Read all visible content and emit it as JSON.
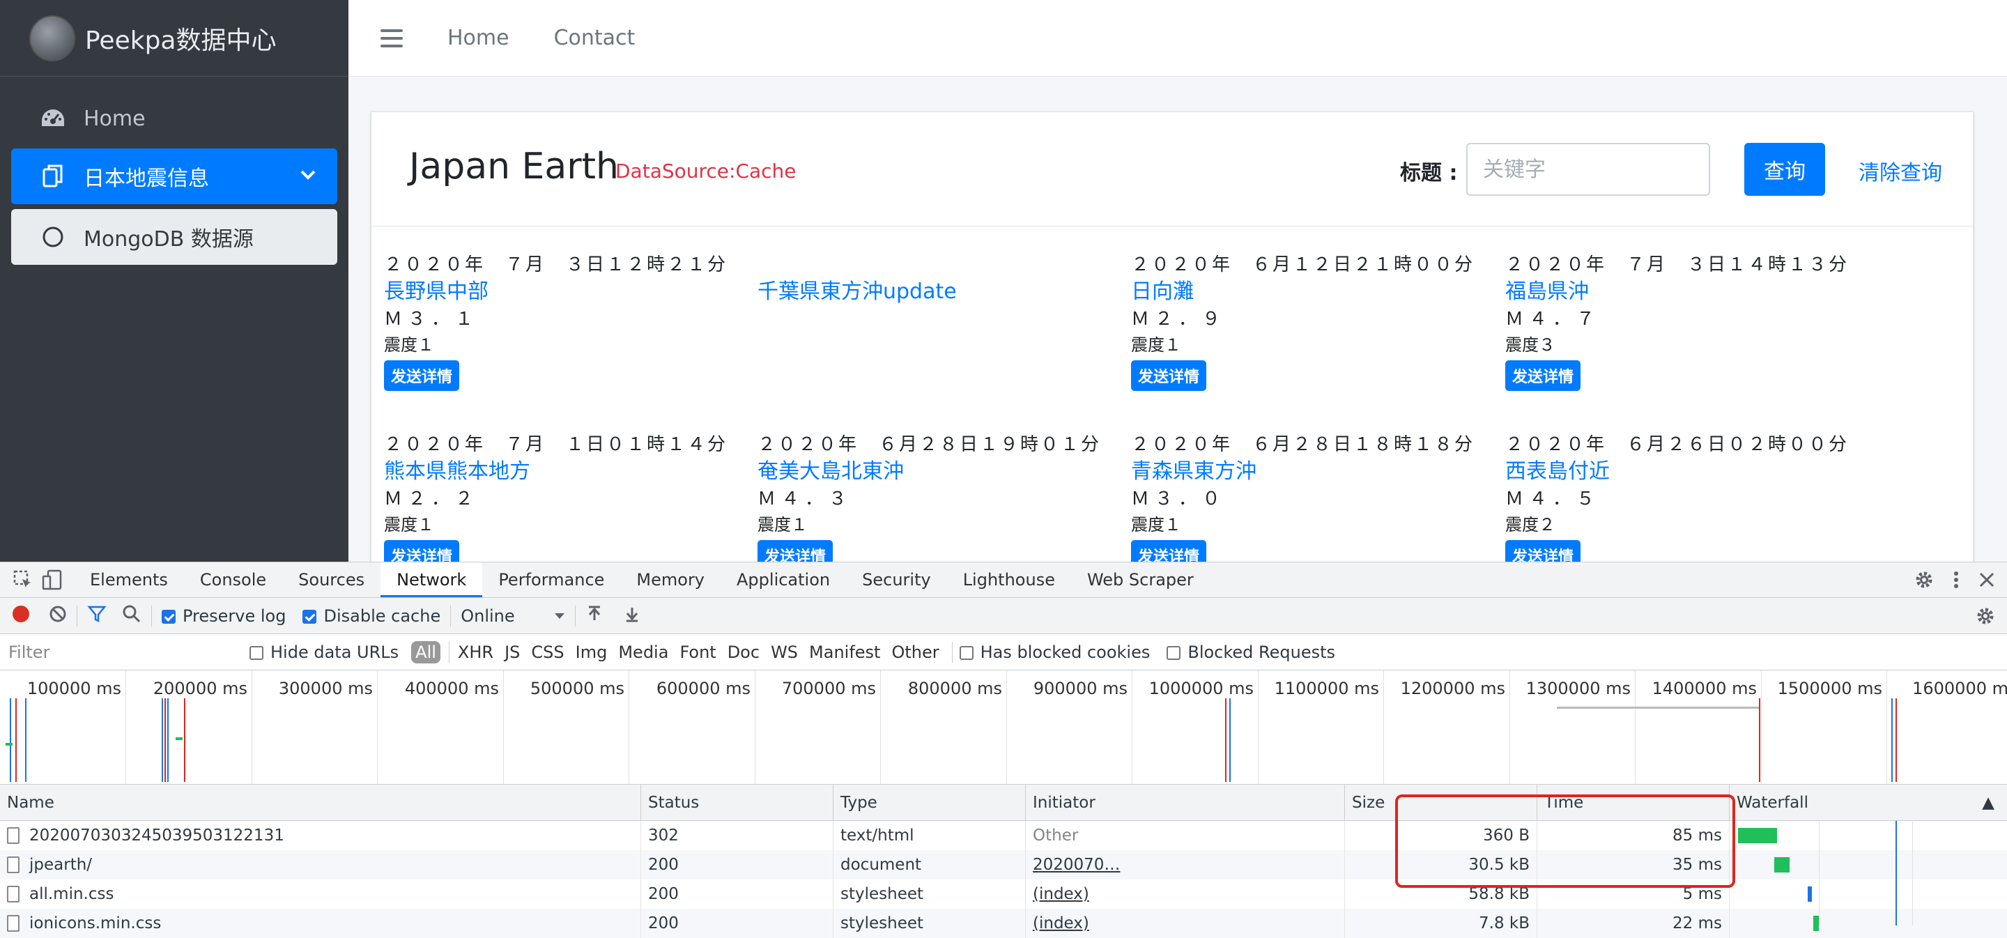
{
  "sidebar": {
    "brand": "Peekpa数据中心",
    "items": [
      {
        "label": "Home"
      },
      {
        "label": "日本地震信息"
      },
      {
        "label": "MongoDB 数据源"
      }
    ]
  },
  "topnav": {
    "links": [
      "Home",
      "Contact"
    ]
  },
  "card": {
    "title": "Japan Earth",
    "source": "DataSource:Cache",
    "search_label": "标题 :",
    "search_placeholder": "关键字",
    "query_button": "查询",
    "clear_button": "清除查询"
  },
  "quakes": [
    {
      "date": "２０２０年　７月　３日１２時２１分",
      "place": "長野県中部",
      "mag": "Ｍ３．１",
      "intensity": "震度１",
      "button": "发送详情"
    },
    {
      "date": "",
      "place": "千葉県東方沖update",
      "mag": "",
      "intensity": "",
      "button": ""
    },
    {
      "date": "２０２０年　６月１２日２１時００分",
      "place": "日向灘",
      "mag": "Ｍ２．９",
      "intensity": "震度１",
      "button": "发送详情"
    },
    {
      "date": "２０２０年　７月　３日１４時１３分",
      "place": "福島県沖",
      "mag": "Ｍ４．７",
      "intensity": "震度３",
      "button": "发送详情"
    },
    {
      "date": "２０２０年　７月　１日０１時１４分",
      "place": "熊本県熊本地方",
      "mag": "Ｍ２．２",
      "intensity": "震度１",
      "button": "发送详情"
    },
    {
      "date": "２０２０年　６月２８日１９時０１分",
      "place": "奄美大島北東沖",
      "mag": "Ｍ４．３",
      "intensity": "震度１",
      "button": "发送详情"
    },
    {
      "date": "２０２０年　６月２８日１８時１８分",
      "place": "青森県東方沖",
      "mag": "Ｍ３．０",
      "intensity": "震度１",
      "button": "发送详情"
    },
    {
      "date": "２０２０年　６月２６日０２時００分",
      "place": "西表島付近",
      "mag": "Ｍ４．５",
      "intensity": "震度２",
      "button": "发送详情"
    }
  ],
  "devtools": {
    "tabs": [
      "Elements",
      "Console",
      "Sources",
      "Network",
      "Performance",
      "Memory",
      "Application",
      "Security",
      "Lighthouse",
      "Web Scraper"
    ],
    "active_tab": "Network",
    "toolbar": {
      "preserve_log": "Preserve log",
      "disable_cache": "Disable cache",
      "throttle": "Online"
    },
    "filterbar": {
      "placeholder": "Filter",
      "hide_data_urls": "Hide data URLs",
      "types": [
        "All",
        "XHR",
        "JS",
        "CSS",
        "Img",
        "Media",
        "Font",
        "Doc",
        "WS",
        "Manifest",
        "Other"
      ],
      "has_blocked_cookies": "Has blocked cookies",
      "blocked_requests": "Blocked Requests"
    },
    "overview_labels": [
      "100000 ms",
      "200000 ms",
      "300000 ms",
      "400000 ms",
      "500000 ms",
      "600000 ms",
      "700000 ms",
      "800000 ms",
      "900000 ms",
      "1000000 ms",
      "1100000 ms",
      "1200000 ms",
      "1300000 ms",
      "1400000 ms",
      "1500000 ms",
      "1600000 m"
    ],
    "columns": [
      "Name",
      "Status",
      "Type",
      "Initiator",
      "Size",
      "Time",
      "Waterfall"
    ],
    "rows": [
      {
        "name": "20200703032450395031221​31",
        "status": "302",
        "type": "text/html",
        "initiator": "Other",
        "size": "360 B",
        "time": "85 ms"
      },
      {
        "name": "jpearth/",
        "status": "200",
        "type": "document",
        "initiator": "2020070…",
        "size": "30.5 kB",
        "time": "35 ms"
      },
      {
        "name": "all.min.css",
        "status": "200",
        "type": "stylesheet",
        "initiator": "(index)",
        "size": "58.8 kB",
        "time": "5 ms"
      },
      {
        "name": "ionicons.min.css",
        "status": "200",
        "type": "stylesheet",
        "initiator": "(index)",
        "size": "7.8 kB",
        "time": "22 ms"
      }
    ]
  },
  "colors": {
    "sidebar_bg": "#343a40",
    "accent": "#007bff",
    "danger": "#dc3545",
    "highlight_box": "#e0251c",
    "waterfall_green": "#1fbf59"
  }
}
